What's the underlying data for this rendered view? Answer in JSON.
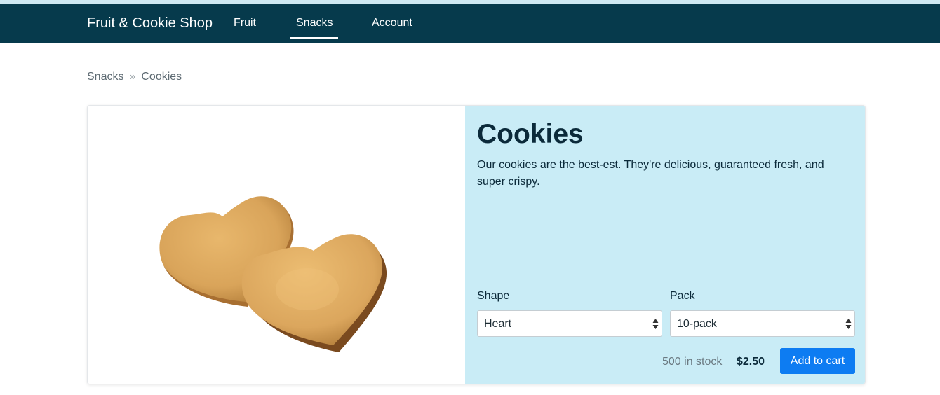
{
  "header": {
    "brand": "Fruit & Cookie Shop",
    "nav": [
      {
        "label": "Fruit"
      },
      {
        "label": "Snacks",
        "active": true
      },
      {
        "label": "Account"
      }
    ]
  },
  "breadcrumb": {
    "items": [
      "Snacks",
      "Cookies"
    ],
    "separator": "»"
  },
  "product": {
    "title": "Cookies",
    "description": "Our cookies are the best-est. They're delicious, guaranteed fresh, and super crispy.",
    "image_icon": "heart-cookies-image",
    "options": {
      "shape": {
        "label": "Shape",
        "value": "Heart"
      },
      "pack": {
        "label": "Pack",
        "value": "10-pack"
      }
    },
    "stock": "500 in stock",
    "price": "$2.50",
    "add_to_cart_label": "Add to cart"
  },
  "colors": {
    "navbar": "#063a4c",
    "info_panel": "#c9ecf6",
    "primary_button": "#0d7cf2"
  }
}
